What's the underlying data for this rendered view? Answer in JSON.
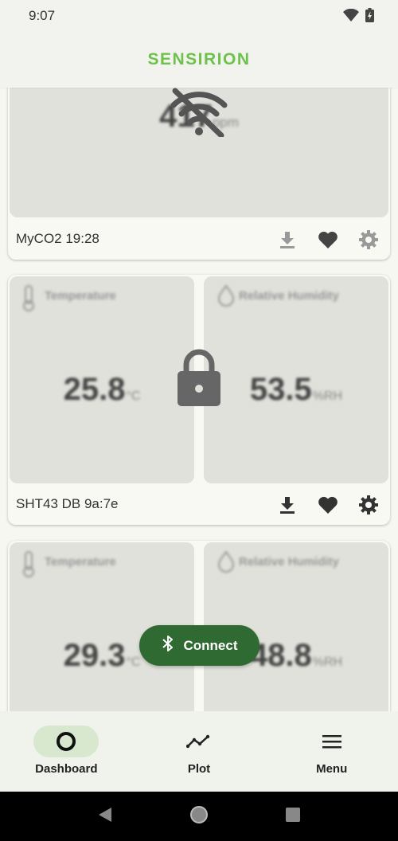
{
  "status_bar": {
    "time": "9:07"
  },
  "header": {
    "brand": "SENSIRION"
  },
  "cards": [
    {
      "name": "MyCO2 19:28",
      "value": "417",
      "unit": "ppm",
      "state": "disconnected"
    },
    {
      "name": "SHT43 DB 9a:7e",
      "state": "locked",
      "panels": [
        {
          "title": "Temperature",
          "value": "25.8",
          "unit": "°C"
        },
        {
          "title": "Relative Humidity",
          "value": "53.5",
          "unit": "%RH"
        }
      ]
    },
    {
      "name": "",
      "panels": [
        {
          "title": "Temperature",
          "value": "29.3",
          "unit": "°C"
        },
        {
          "title": "Relative Humidity",
          "value": "48.8",
          "unit": "%RH"
        }
      ]
    }
  ],
  "connect_button": {
    "label": "Connect"
  },
  "bottom_nav": [
    {
      "label": "Dashboard",
      "icon": "circle-icon",
      "active": true
    },
    {
      "label": "Plot",
      "icon": "trend-line-icon",
      "active": false
    },
    {
      "label": "Menu",
      "icon": "hamburger-icon",
      "active": false
    }
  ],
  "colors": {
    "brand_green": "#6cc24a",
    "connect_green": "#2f6a33",
    "active_pill": "#d7e8cf",
    "panel_gray": "#dfe1da"
  }
}
